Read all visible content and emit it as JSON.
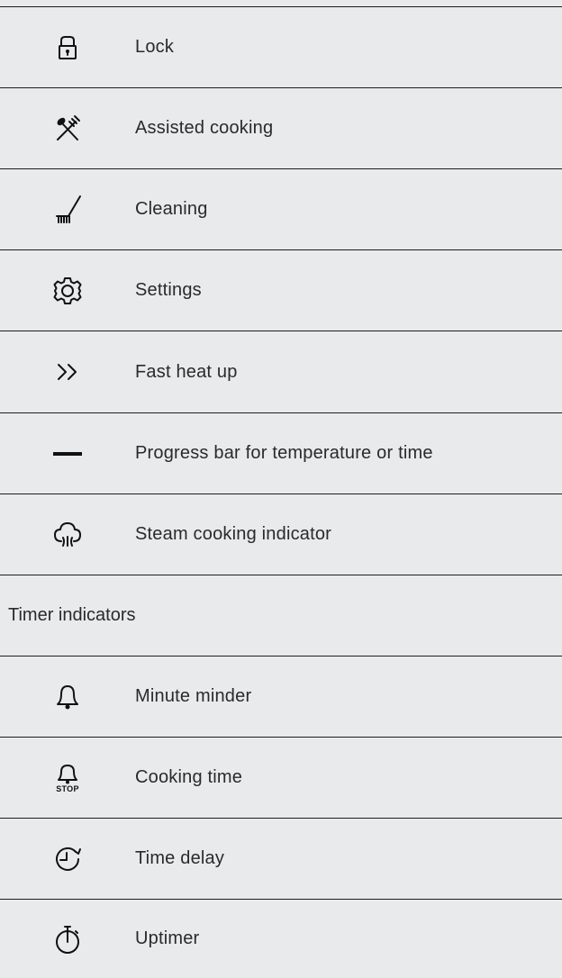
{
  "rows": [
    {
      "icon": "lock-icon",
      "label": "Lock"
    },
    {
      "icon": "assisted-cooking-icon",
      "label": "Assisted cooking"
    },
    {
      "icon": "cleaning-brush-icon",
      "label": "Cleaning"
    },
    {
      "icon": "gear-icon",
      "label": "Settings"
    },
    {
      "icon": "double-chevron-icon",
      "label": "Fast heat up"
    },
    {
      "icon": "progress-bar-icon",
      "label": "Progress bar for temperature or time"
    },
    {
      "icon": "steam-icon",
      "label": "Steam cooking indicator"
    }
  ],
  "section": {
    "title": "Timer indicators"
  },
  "timer_rows": [
    {
      "icon": "bell-icon",
      "label": "Minute minder"
    },
    {
      "icon": "bell-stop-icon",
      "label": "Cooking time",
      "icon_text": "STOP"
    },
    {
      "icon": "clock-arrow-icon",
      "label": "Time delay"
    },
    {
      "icon": "stopwatch-icon",
      "label": "Uptimer"
    }
  ]
}
